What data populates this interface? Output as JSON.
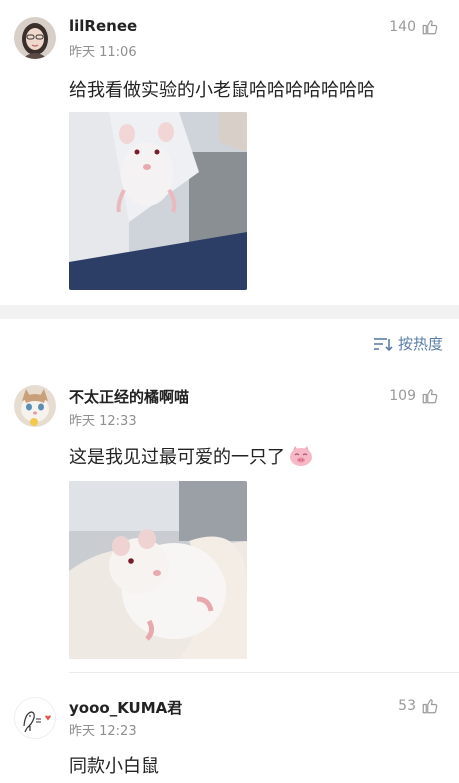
{
  "sort": {
    "label": "按热度",
    "icon": "sort-lines-icon",
    "color": "#5b7fa8"
  },
  "comments": [
    {
      "username": "lilRenee",
      "time": "昨天 11:06",
      "likes": "140",
      "text": "给我看做实验的小老鼠哈哈哈哈哈哈哈",
      "avatar": "girl-portrait-avatar",
      "image": "white-lab-mouse-held-photo"
    },
    {
      "username": "不太正经的橘啊喵",
      "time": "昨天 12:33",
      "likes": "109",
      "text": "这是我见过最可爱的一只了",
      "emoji": "pink-pig-face-emoji",
      "avatar": "kitten-avatar",
      "image": "white-mouse-in-gloved-hand-photo"
    },
    {
      "username": "yooo_KUMA君",
      "time": "昨天 12:23",
      "likes": "53",
      "text": "同款小白鼠",
      "avatar": "doodle-sketch-avatar"
    }
  ]
}
